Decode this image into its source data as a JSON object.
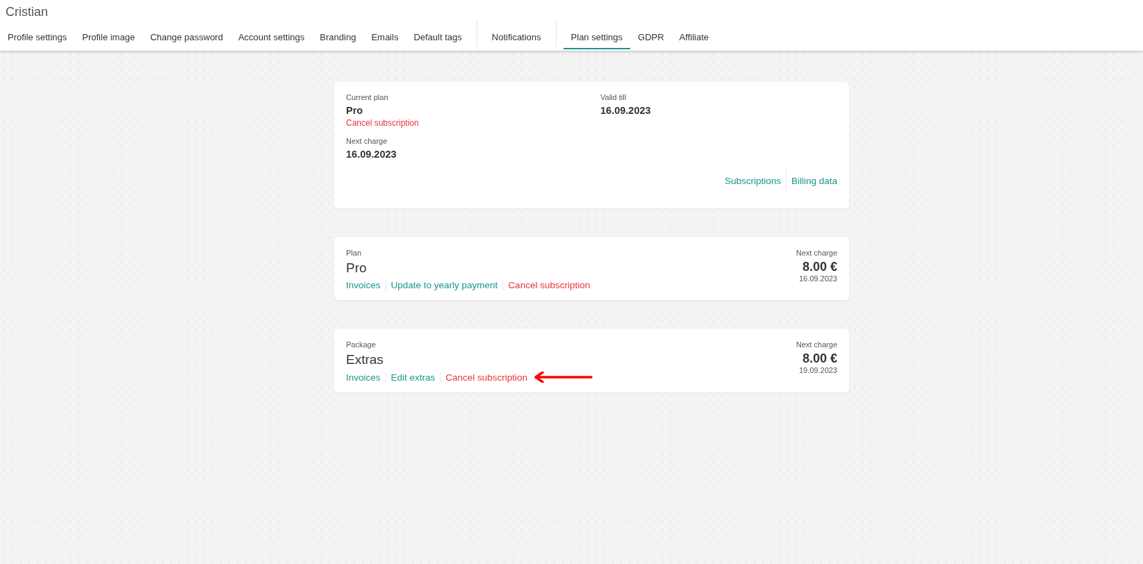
{
  "header": {
    "title": "Cristian"
  },
  "tabs": [
    {
      "label": "Profile settings",
      "selected": false,
      "separator_before": false
    },
    {
      "label": "Profile image",
      "selected": false,
      "separator_before": false
    },
    {
      "label": "Change password",
      "selected": false,
      "separator_before": false
    },
    {
      "label": "Account settings",
      "selected": false,
      "separator_before": false
    },
    {
      "label": "Branding",
      "selected": false,
      "separator_before": false
    },
    {
      "label": "Emails",
      "selected": false,
      "separator_before": false
    },
    {
      "label": "Default tags",
      "selected": false,
      "separator_before": false
    },
    {
      "label": "Notifications",
      "selected": false,
      "separator_before": true
    },
    {
      "label": "Plan settings",
      "selected": true,
      "separator_before": true
    },
    {
      "label": "GDPR",
      "selected": false,
      "separator_before": false
    },
    {
      "label": "Affiliate",
      "selected": false,
      "separator_before": false
    }
  ],
  "overview": {
    "current_plan_label": "Current plan",
    "current_plan": "Pro",
    "cancel_link": "Cancel subscription",
    "valid_till_label": "Valid till",
    "valid_till": "16.09.2023",
    "next_charge_label": "Next charge",
    "next_charge": "16.09.2023",
    "links": [
      "Subscriptions",
      "Billing data"
    ]
  },
  "subscriptions": [
    {
      "type_label": "Plan",
      "name": "Pro",
      "next_charge_label": "Next charge",
      "amount": "8.00 €",
      "date": "16.09.2023",
      "links": [
        {
          "label": "Invoices",
          "kind": "normal",
          "arrow": false
        },
        {
          "label": "Update to yearly payment",
          "kind": "normal",
          "arrow": false
        },
        {
          "label": "Cancel subscription",
          "kind": "danger",
          "arrow": false
        }
      ]
    },
    {
      "type_label": "Package",
      "name": "Extras",
      "next_charge_label": "Next charge",
      "amount": "8.00 €",
      "date": "19.09.2023",
      "links": [
        {
          "label": "Invoices",
          "kind": "normal",
          "arrow": false
        },
        {
          "label": "Edit extras",
          "kind": "normal",
          "arrow": false
        },
        {
          "label": "Cancel subscription",
          "kind": "danger",
          "arrow": true
        }
      ]
    }
  ]
}
